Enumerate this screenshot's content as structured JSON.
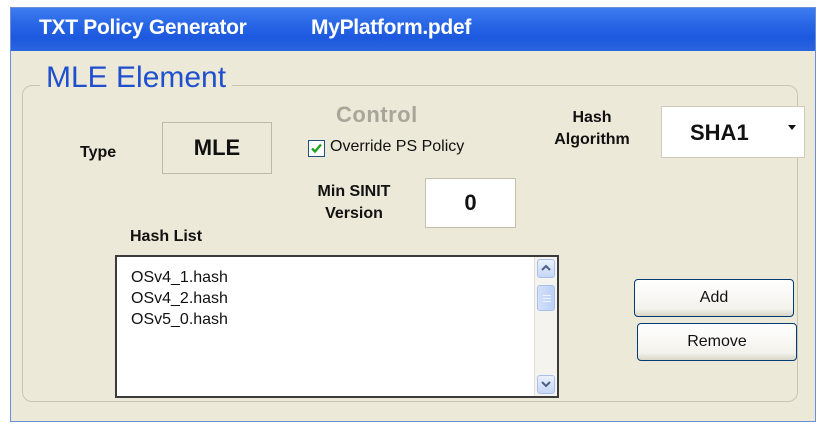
{
  "window": {
    "title": "TXT Policy Generator",
    "file": "MyPlatform.pdef"
  },
  "group": {
    "title": "MLE Element"
  },
  "type": {
    "label": "Type",
    "value": "MLE"
  },
  "control": {
    "label": "Control",
    "override_label": "Override PS Policy",
    "override_checked": true
  },
  "hash_algorithm": {
    "label_line1": "Hash",
    "label_line2": "Algorithm",
    "selected": "SHA1"
  },
  "min_sinit": {
    "label_line1": "Min SINIT",
    "label_line2": "Version",
    "value": "0"
  },
  "hash_list": {
    "label": "Hash List",
    "items": [
      "OSv4_1.hash",
      "OSv4_2.hash",
      "OSv5_0.hash"
    ]
  },
  "buttons": {
    "add": "Add",
    "remove": "Remove"
  },
  "colors": {
    "titlebar": "#2a67e6",
    "group_title": "#1f4fcf",
    "check": "#21a121",
    "control_disabled": "#a8a59a"
  }
}
